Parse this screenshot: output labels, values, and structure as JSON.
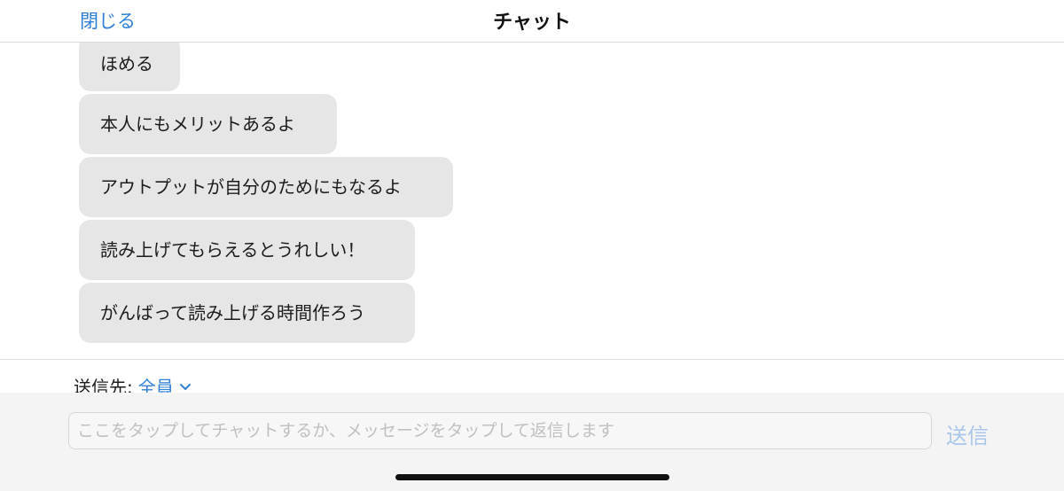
{
  "header": {
    "close_label": "閉じる",
    "title": "チャット"
  },
  "messages": [
    {
      "text": "ほめる"
    },
    {
      "text": "本人にもメリットあるよ"
    },
    {
      "text": "アウトプットが自分のためにもなるよ"
    },
    {
      "text": "読み上げてもらえるとうれしい！"
    },
    {
      "text": "がんばって読み上げる時間作ろう"
    }
  ],
  "recipient": {
    "label": "送信先:",
    "target": "全員",
    "icon": "chevron-down-icon"
  },
  "composer": {
    "placeholder": "ここをタップしてチャットするか、メッセージをタップして返信します",
    "send_label": "送信"
  },
  "colors": {
    "accent": "#2f7fd6",
    "bubble": "#e6e6e6",
    "send_disabled": "#a9c6ea"
  }
}
